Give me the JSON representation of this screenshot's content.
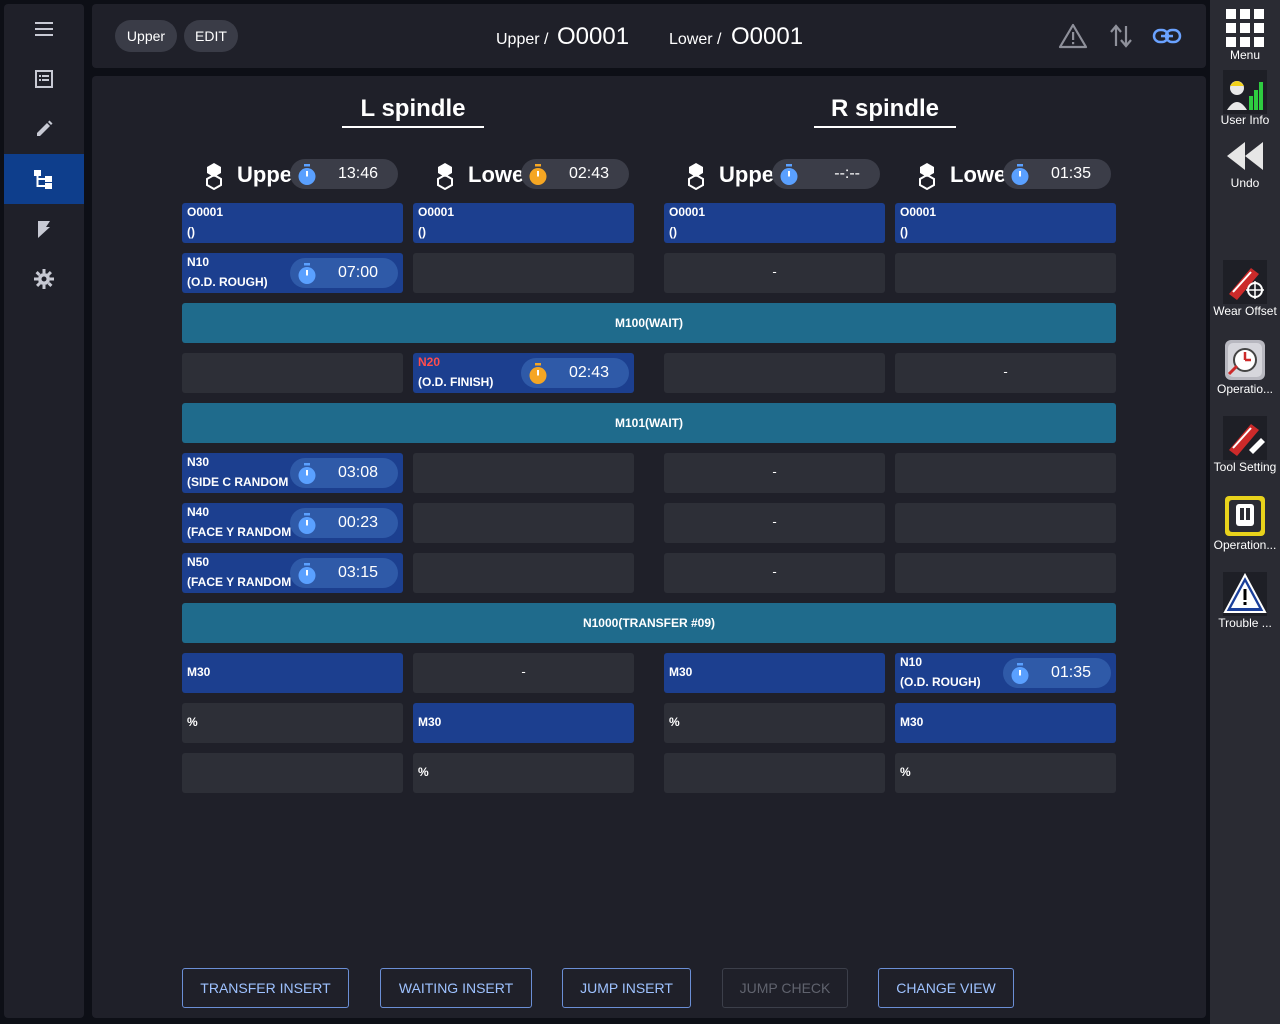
{
  "left_nav": {
    "items": [
      {
        "name": "menu-icon"
      },
      {
        "name": "list-icon"
      },
      {
        "name": "pencil-icon"
      },
      {
        "name": "flow-chart-icon",
        "active": true
      },
      {
        "name": "bookmark-icon"
      },
      {
        "name": "gear-icon"
      }
    ]
  },
  "header": {
    "mode_badge": "Upper",
    "edit_badge": "EDIT",
    "upper_label": "Upper /",
    "upper_program": "O0001",
    "lower_label": "Lower /",
    "lower_program": "O0001",
    "icons": [
      "warning-icon",
      "swap-vertical-icon",
      "link-icon"
    ]
  },
  "spindles": {
    "left_title": "L spindle",
    "right_title": "R spindle"
  },
  "columns": [
    {
      "label": "Upper",
      "timer": "13:46",
      "timer_color": "#5aa0ff"
    },
    {
      "label": "Lower",
      "timer": "02:43",
      "timer_color": "#f5a623"
    },
    {
      "label": "Upper",
      "timer": "--:--",
      "timer_color": "#5aa0ff"
    },
    {
      "label": "Lower",
      "timer": "01:35",
      "timer_color": "#5aa0ff"
    }
  ],
  "rows": [
    {
      "kind": "cells",
      "cells": [
        {
          "style": "blue",
          "l1": "O0001",
          "l2": "()"
        },
        {
          "style": "blue",
          "l1": "O0001",
          "l2": "()"
        },
        {
          "style": "blue",
          "l1": "O0001",
          "l2": "()"
        },
        {
          "style": "blue",
          "l1": "O0001",
          "l2": "()"
        }
      ]
    },
    {
      "kind": "cells",
      "cells": [
        {
          "style": "blue",
          "l1": "N10",
          "l2": "(O.D. ROUGH)",
          "timer": "07:00",
          "timer_color": "#5aa0ff"
        },
        {
          "style": "gray"
        },
        {
          "style": "gray",
          "dash": "-"
        },
        {
          "style": "gray"
        }
      ]
    },
    {
      "kind": "wait",
      "text": "M100(WAIT)"
    },
    {
      "kind": "cells",
      "cells": [
        {
          "style": "gray"
        },
        {
          "style": "blue",
          "l1": "N20",
          "l1_color": "#ff4d4d",
          "l2": "(O.D. FINISH)",
          "timer": "02:43",
          "timer_color": "#f5a623"
        },
        {
          "style": "gray"
        },
        {
          "style": "gray",
          "dash": "-"
        }
      ]
    },
    {
      "kind": "wait",
      "text": "M101(WAIT)"
    },
    {
      "kind": "cells",
      "cells": [
        {
          "style": "blue",
          "l1": "N30",
          "l2": "(SIDE C RANDOM",
          "timer": "03:08",
          "timer_color": "#5aa0ff"
        },
        {
          "style": "gray"
        },
        {
          "style": "gray",
          "dash": "-"
        },
        {
          "style": "gray"
        }
      ]
    },
    {
      "kind": "cells",
      "cells": [
        {
          "style": "blue",
          "l1": "N40",
          "l2": "(FACE Y RANDOM",
          "timer": "00:23",
          "timer_color": "#5aa0ff"
        },
        {
          "style": "gray"
        },
        {
          "style": "gray",
          "dash": "-"
        },
        {
          "style": "gray"
        }
      ]
    },
    {
      "kind": "cells",
      "cells": [
        {
          "style": "blue",
          "l1": "N50",
          "l2": "(FACE Y RANDOM",
          "timer": "03:15",
          "timer_color": "#5aa0ff"
        },
        {
          "style": "gray"
        },
        {
          "style": "gray",
          "dash": "-"
        },
        {
          "style": "gray"
        }
      ]
    },
    {
      "kind": "wait",
      "text": "N1000(TRANSFER #09)"
    },
    {
      "kind": "cells",
      "cells": [
        {
          "style": "blue",
          "single": "M30"
        },
        {
          "style": "gray",
          "dash": "-"
        },
        {
          "style": "blue",
          "single": "M30"
        },
        {
          "style": "blue",
          "l1": "N10",
          "l2": "(O.D. ROUGH)",
          "timer": "01:35",
          "timer_color": "#5aa0ff"
        }
      ]
    },
    {
      "kind": "cells",
      "cells": [
        {
          "style": "gray",
          "single": "%"
        },
        {
          "style": "blue",
          "single": "M30"
        },
        {
          "style": "gray",
          "single": "%"
        },
        {
          "style": "blue",
          "single": "M30"
        }
      ]
    },
    {
      "kind": "cells",
      "cells": [
        {
          "style": "gray"
        },
        {
          "style": "gray",
          "single": "%"
        },
        {
          "style": "gray"
        },
        {
          "style": "gray",
          "single": "%"
        }
      ]
    }
  ],
  "actions": {
    "transfer_insert": "TRANSFER INSERT",
    "waiting_insert": "WAITING INSERT",
    "jump_insert": "JUMP INSERT",
    "jump_check": "JUMP CHECK",
    "change_view": "CHANGE VIEW"
  },
  "right_bar": {
    "menu": "Menu",
    "user_info": "User Info",
    "undo": "Undo",
    "wear_offset": "Wear Offset",
    "operation_1": "Operatio...",
    "tool_setting": "Tool Setting",
    "operation_2": "Operation...",
    "trouble": "Trouble ..."
  }
}
